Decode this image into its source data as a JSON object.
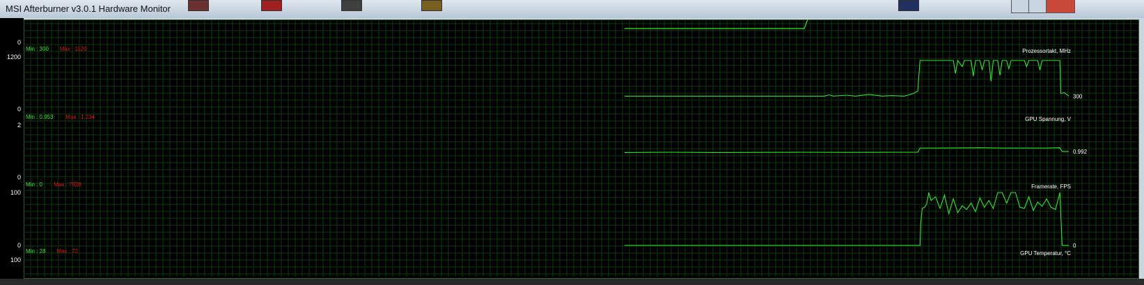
{
  "window": {
    "title": "MSI Afterburner v3.0.1 Hardware Monitor",
    "controls": [
      "minimize",
      "maximize",
      "close"
    ]
  },
  "colors": {
    "background": "#000000",
    "grid": "#0d3a0d",
    "graph_line": "#2ee82e",
    "min_label": "#2ee82e",
    "max_label": "#e01010",
    "text": "#ffffff"
  },
  "top_partial_graph": {
    "y_bottom_label": "0"
  },
  "graphs": [
    {
      "id": "core_clock",
      "title": "Prozessortakt, MHz",
      "min_label": "Min : 300",
      "max_label": "Max : 1120",
      "y_top": "1200",
      "y_bottom": "0",
      "current_value": "300",
      "y_max": 1200,
      "series": [
        [
          0,
          300
        ],
        [
          0.45,
          300
        ],
        [
          0.46,
          330
        ],
        [
          0.47,
          300
        ],
        [
          0.5,
          320
        ],
        [
          0.52,
          300
        ],
        [
          0.55,
          340
        ],
        [
          0.58,
          300
        ],
        [
          0.6,
          310
        ],
        [
          0.63,
          300
        ],
        [
          0.65,
          360
        ],
        [
          0.66,
          420
        ],
        [
          0.665,
          1120
        ],
        [
          0.7,
          1120
        ],
        [
          0.74,
          1120
        ],
        [
          0.745,
          820
        ],
        [
          0.75,
          1120
        ],
        [
          0.76,
          980
        ],
        [
          0.765,
          1120
        ],
        [
          0.78,
          1120
        ],
        [
          0.785,
          760
        ],
        [
          0.79,
          1120
        ],
        [
          0.8,
          1120
        ],
        [
          0.805,
          900
        ],
        [
          0.81,
          1120
        ],
        [
          0.82,
          1120
        ],
        [
          0.825,
          640
        ],
        [
          0.83,
          1120
        ],
        [
          0.84,
          1120
        ],
        [
          0.845,
          780
        ],
        [
          0.85,
          1120
        ],
        [
          0.86,
          1120
        ],
        [
          0.865,
          930
        ],
        [
          0.87,
          1120
        ],
        [
          0.9,
          1120
        ],
        [
          0.905,
          980
        ],
        [
          0.91,
          1120
        ],
        [
          0.93,
          1120
        ],
        [
          0.935,
          900
        ],
        [
          0.94,
          1120
        ],
        [
          0.97,
          1120
        ],
        [
          0.98,
          1120
        ],
        [
          0.982,
          360
        ],
        [
          0.99,
          380
        ],
        [
          1,
          300
        ]
      ]
    },
    {
      "id": "gpu_voltage",
      "title": "GPU Spannung, V",
      "min_label": "Min : 0.953",
      "max_label": "Max : 1.234",
      "y_top": "2",
      "y_bottom": "0",
      "current_value": "0.992",
      "y_max": 2,
      "series": [
        [
          0,
          0.95
        ],
        [
          0.05,
          0.955
        ],
        [
          0.1,
          0.96
        ],
        [
          0.2,
          0.95
        ],
        [
          0.3,
          0.955
        ],
        [
          0.4,
          0.96
        ],
        [
          0.5,
          0.955
        ],
        [
          0.6,
          0.96
        ],
        [
          0.66,
          0.96
        ],
        [
          0.665,
          1.12
        ],
        [
          0.7,
          1.12
        ],
        [
          0.8,
          1.13
        ],
        [
          0.85,
          1.12
        ],
        [
          0.9,
          1.12
        ],
        [
          0.95,
          1.12
        ],
        [
          0.98,
          1.13
        ],
        [
          0.985,
          0.99
        ],
        [
          1,
          0.99
        ]
      ]
    },
    {
      "id": "framerate",
      "title": "Framerate, FPS",
      "min_label": "Min : 0",
      "max_label": "Max : 7928",
      "y_top": "100",
      "y_bottom": "0",
      "current_value": "0",
      "y_max": 100,
      "series": [
        [
          0,
          0
        ],
        [
          0.665,
          0
        ],
        [
          0.667,
          45
        ],
        [
          0.67,
          70
        ],
        [
          0.675,
          72
        ],
        [
          0.68,
          78
        ],
        [
          0.685,
          100
        ],
        [
          0.69,
          85
        ],
        [
          0.7,
          92
        ],
        [
          0.71,
          70
        ],
        [
          0.72,
          95
        ],
        [
          0.73,
          60
        ],
        [
          0.74,
          88
        ],
        [
          0.75,
          62
        ],
        [
          0.76,
          75
        ],
        [
          0.77,
          68
        ],
        [
          0.78,
          80
        ],
        [
          0.79,
          64
        ],
        [
          0.8,
          90
        ],
        [
          0.81,
          72
        ],
        [
          0.82,
          85
        ],
        [
          0.83,
          70
        ],
        [
          0.84,
          100
        ],
        [
          0.85,
          100
        ],
        [
          0.86,
          80
        ],
        [
          0.87,
          100
        ],
        [
          0.88,
          100
        ],
        [
          0.89,
          72
        ],
        [
          0.9,
          70
        ],
        [
          0.91,
          92
        ],
        [
          0.92,
          66
        ],
        [
          0.93,
          82
        ],
        [
          0.94,
          74
        ],
        [
          0.95,
          88
        ],
        [
          0.96,
          72
        ],
        [
          0.97,
          68
        ],
        [
          0.98,
          100
        ],
        [
          0.985,
          0
        ],
        [
          1,
          0
        ]
      ]
    },
    {
      "id": "gpu_temperature",
      "title": "GPU Temperatur, °C",
      "min_label": "Min : 28",
      "max_label": "Max : 72",
      "y_top": "100",
      "y_bottom": "",
      "current_value": "",
      "y_max": 100,
      "series": []
    }
  ]
}
